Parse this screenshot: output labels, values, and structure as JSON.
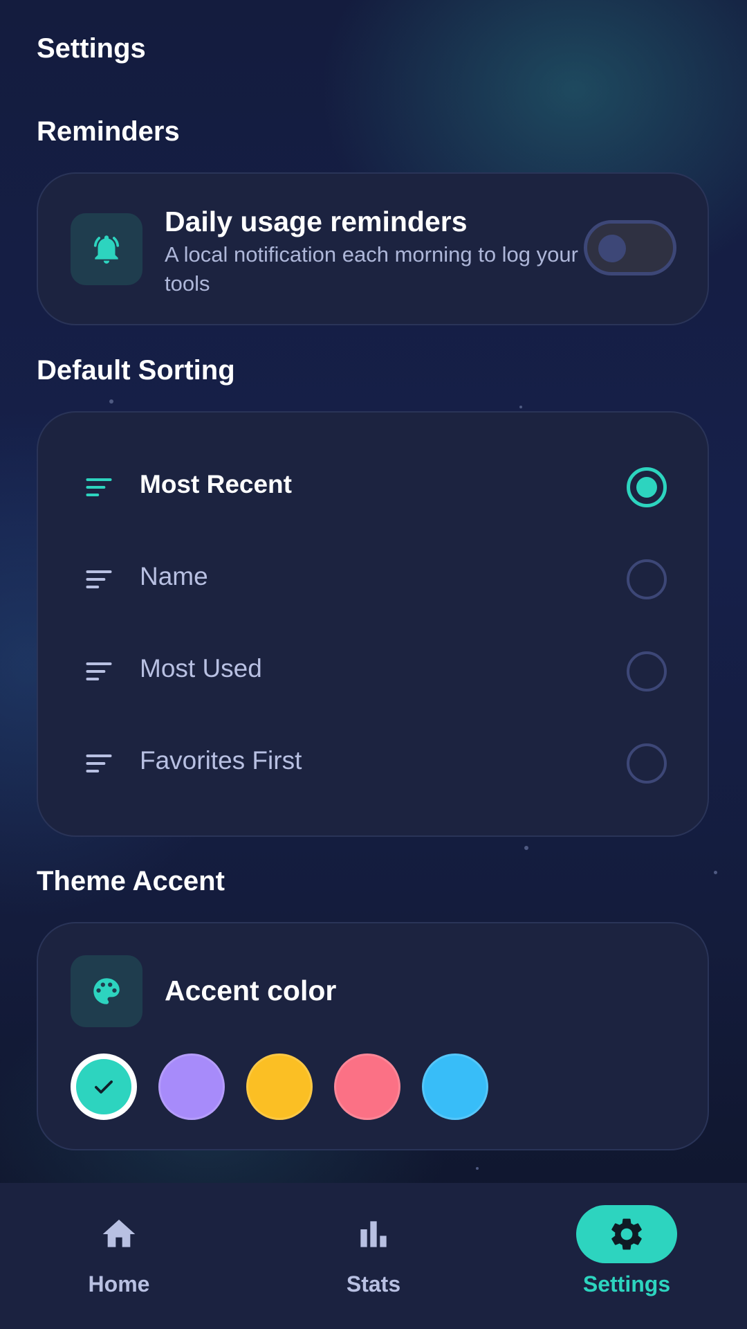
{
  "header": {
    "title": "Settings"
  },
  "reminders": {
    "section_title": "Reminders",
    "title": "Daily usage reminders",
    "subtitle": "A local notification each morning to log your tools",
    "toggle_on": false,
    "icon": "bell-ring-icon"
  },
  "sorting": {
    "section_title": "Default Sorting",
    "options": [
      {
        "label": "Most Recent",
        "selected": true
      },
      {
        "label": "Name",
        "selected": false
      },
      {
        "label": "Most Used",
        "selected": false
      },
      {
        "label": "Favorites First",
        "selected": false
      }
    ],
    "icon": "sort-lines-icon"
  },
  "theme": {
    "section_title": "Theme Accent",
    "title": "Accent color",
    "icon": "palette-icon",
    "swatches": [
      {
        "color": "#2dd4bf",
        "selected": true
      },
      {
        "color": "#a78bfa",
        "selected": false
      },
      {
        "color": "#fbbf24",
        "selected": false
      },
      {
        "color": "#fb7185",
        "selected": false
      },
      {
        "color": "#38bdf8",
        "selected": false
      }
    ]
  },
  "nav": {
    "items": [
      {
        "label": "Home",
        "icon": "home-icon",
        "active": false
      },
      {
        "label": "Stats",
        "icon": "bar-chart-icon",
        "active": false
      },
      {
        "label": "Settings",
        "icon": "gear-icon",
        "active": true
      }
    ]
  },
  "colors": {
    "accent": "#2dd4bf",
    "card": "#1c2340",
    "muted_text": "#b8c0e2",
    "inactive_outline": "#3d4777"
  }
}
